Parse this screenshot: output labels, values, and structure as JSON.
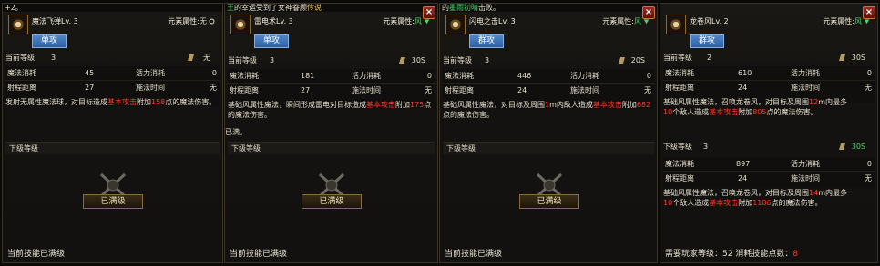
{
  "colors": {
    "accent_red": "#ff3a2a",
    "accent_green": "#49d76b",
    "tag_blue": "#3d72b6"
  },
  "panels": [
    {
      "top_text": "+2。",
      "skill_name": "魔法飞弹Lv. 3",
      "element_label": "元素属性:",
      "element_value": "无",
      "element_icon": "circle-icon",
      "tag": "单攻",
      "current_level_label": "当前等级",
      "current_level": "3",
      "time": "无",
      "stats": {
        "mp_label": "魔法消耗",
        "mp": "45",
        "vp_label": "活力消耗",
        "vp": "0",
        "range_label": "射程距离",
        "range": "27",
        "cast_label": "施法时间",
        "cast": "无"
      },
      "desc_a": "发射无属性魔法球，对目标造成",
      "desc_red": "基本攻击",
      "desc_b": "附加",
      "desc_red2": "158",
      "desc_c": "点的魔法伤害。",
      "next_label": "下级等级",
      "max_label": "已满级",
      "footer": "当前技能已满级"
    },
    {
      "top_text_green": "王",
      "top_text": "的幸运受到了女神眷顾",
      "top_text_gold": "传说",
      "skill_name": "雷电术Lv. 3",
      "element_label": "元素属性:",
      "element_value": "风",
      "element_icon": "wind-icon",
      "tag": "单攻",
      "current_level_label": "当前等级",
      "current_level": "3",
      "time": "30S",
      "stats": {
        "mp_label": "魔法消耗",
        "mp": "181",
        "vp_label": "活力消耗",
        "vp": "0",
        "range_label": "射程距离",
        "range": "27",
        "cast_label": "施法时间",
        "cast": "无"
      },
      "desc_a": "基础风属性魔法，瞬间形成雷电对目标造成",
      "desc_red": "基本攻击",
      "desc_b": "附加",
      "desc_red2": "175",
      "desc_c": "点的魔法伤害。",
      "side_note": "已满。",
      "next_label": "下级等级",
      "max_label": "已满级",
      "footer": "当前技能已满级"
    },
    {
      "top_text": "的",
      "top_text_green": "墨雨初晴",
      "top_text_tail": "击败。",
      "skill_name": "闪电之击Lv. 3",
      "element_label": "元素属性:",
      "element_value": "风",
      "element_icon": "wind-icon",
      "tag": "群攻",
      "current_level_label": "当前等级",
      "current_level": "3",
      "time": "20S",
      "stats": {
        "mp_label": "魔法消耗",
        "mp": "446",
        "vp_label": "活力消耗",
        "vp": "0",
        "range_label": "射程距离",
        "range": "24",
        "cast_label": "施法时间",
        "cast": "无"
      },
      "desc_a": "基础风属性魔法，对目标及周围",
      "desc_red3": "1",
      "desc_mid": "m内敌人造成",
      "desc_red": "基本攻击",
      "desc_b": "附加",
      "desc_red2": "682",
      "desc_c": "点的魔法伤害。",
      "next_label": "下级等级",
      "max_label": "已满级",
      "footer": "当前技能已满级"
    },
    {
      "skill_name": "龙卷风Lv. 2",
      "element_label": "元素属性:",
      "element_value": "风",
      "element_icon": "wind-icon",
      "tag": "群攻",
      "current_level_label": "当前等级",
      "current_level": "2",
      "time": "30S",
      "stats": {
        "mp_label": "魔法消耗",
        "mp": "610",
        "vp_label": "活力消耗",
        "vp": "0",
        "range_label": "射程距离",
        "range": "24",
        "cast_label": "施法时间",
        "cast": "无"
      },
      "desc_a": "基础风属性魔法，召唤龙卷风，对目标及周围",
      "desc_red3": "12",
      "desc_mid": "m内最多",
      "desc_red4": "10",
      "desc_mid2": "个敌人造成",
      "desc_red": "基本攻击",
      "desc_b": "附加",
      "desc_red2": "805",
      "desc_c": "点的魔法伤害。",
      "next_label": "下级等级",
      "next_level": "3",
      "next_time": "30S",
      "next_stats": {
        "mp_label": "魔法消耗",
        "mp": "897",
        "vp_label": "活力消耗",
        "vp": "0",
        "range_label": "射程距离",
        "range": "24",
        "cast_label": "施法时间",
        "cast": "无"
      },
      "next_desc_a": "基础风属性魔法，召唤龙卷风，对目标及周围",
      "next_desc_red3": "14",
      "next_desc_mid": "m内最多",
      "next_desc_red4": "10",
      "next_desc_mid2": "个敌人造成",
      "next_desc_red": "基本攻击",
      "next_desc_b": "附加",
      "next_desc_red2": "1186",
      "next_desc_c": "点的魔法伤害。",
      "req_label": "需要玩家等级：",
      "req_level": "52",
      "cost_label": "消耗技能点数：",
      "cost": "8"
    }
  ]
}
